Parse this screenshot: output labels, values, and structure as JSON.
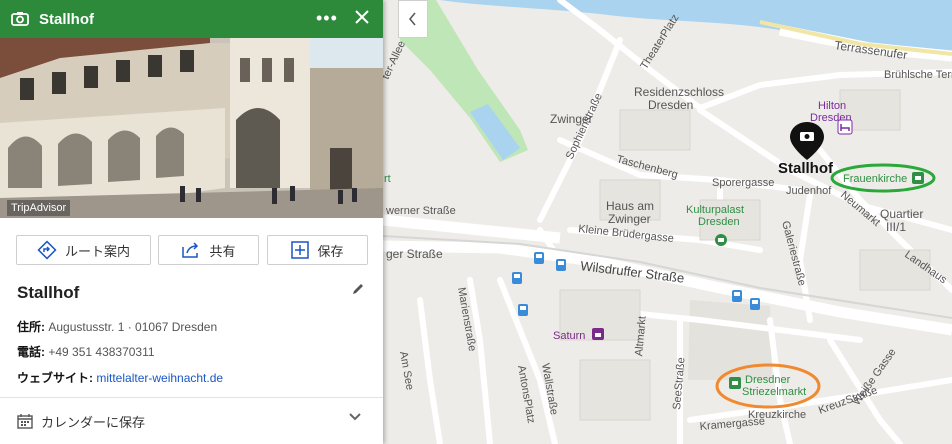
{
  "panel": {
    "title": "Stallhof",
    "more_label": "•••",
    "photo_credit": "TripAdvisor",
    "actions": {
      "route": "ルート案内",
      "share": "共有",
      "save": "保存"
    },
    "name": "Stallhof",
    "address_key": "住所:",
    "address_value": "Augustusstr. 1 · 01067 Dresden",
    "phone_key": "電話:",
    "phone_value": "+49 351 438370311",
    "website_key": "ウェブサイト:",
    "website_value": "mittelalter-weihnacht.de",
    "calendar_label": "カレンダーに保存"
  },
  "map": {
    "selected_pin_label": "Stallhof",
    "labels": {
      "terrassenufer": "Terrassenufer",
      "bruhlsche": "Brühlsche Terr",
      "residenzschloss_1": "Residenzschloss",
      "residenzschloss_2": "Dresden",
      "zwinger": "Zwinger",
      "hilton_1": "Hilton",
      "hilton_2": "Dresden",
      "frauenkirche": "Frauenkirche",
      "taschenberg": "Taschenberg",
      "sporergasse": "Sporergasse",
      "judenhof": "Judenhof",
      "neumarkt": "Neumarkt",
      "quartier_1": "Quartier",
      "quartier_2": "III/1",
      "landhaus": "Landhaus",
      "haus_zwinger_1": "Haus am",
      "haus_zwinger_2": "Zwinger",
      "kleine_brudergasse": "Kleine Brüdergasse",
      "kulturpalast_1": "Kulturpalast",
      "kulturpalast_2": "Dresden",
      "galeriestrasse": "Galeriestraße",
      "wilsdruffer": "Wilsdruffer Straße",
      "ger_strasse": "ger Straße",
      "werner_strasse": "werner Straße",
      "marienstrasse": "Marienstraße",
      "sophienstrasse": "Sophienstraße",
      "theaterplatz": "TheaterPlatz",
      "schlossallee": "ter-Allee",
      "saturn": "Saturn",
      "altmarkt": "Altmarkt",
      "striezelmarkt_1": "Dresdner",
      "striezelmarkt_2": "Striezelmarkt",
      "antonsplatz": "AntonsPlatz",
      "wallstrasse": "Wallstraße",
      "am_see": "Am See",
      "seestrasse": "SeeStraße",
      "kramergasse": "Kramergasse",
      "kreuzkirche": "Kreuzkirche",
      "kreuzstrasse": "KreuzStraße",
      "weisse_gasse": "Weiße Gasse",
      "rt": "rt"
    }
  },
  "colors": {
    "header_green": "#2c8a3a",
    "highlight_green": "#2aa83a",
    "highlight_orange": "#f08a30",
    "poi_green": "#2f8f44",
    "saturn_purple": "#7a2a8a",
    "link_blue": "#1a56c4"
  },
  "icons": {
    "header": "camera-icon",
    "more": "more-icon",
    "close": "close-icon",
    "route": "directions-icon",
    "share": "share-icon",
    "save": "save-icon",
    "edit": "pencil-icon",
    "calendar": "calendar-icon",
    "chevron": "chevron-down-icon",
    "collapse": "chevron-left-icon"
  }
}
